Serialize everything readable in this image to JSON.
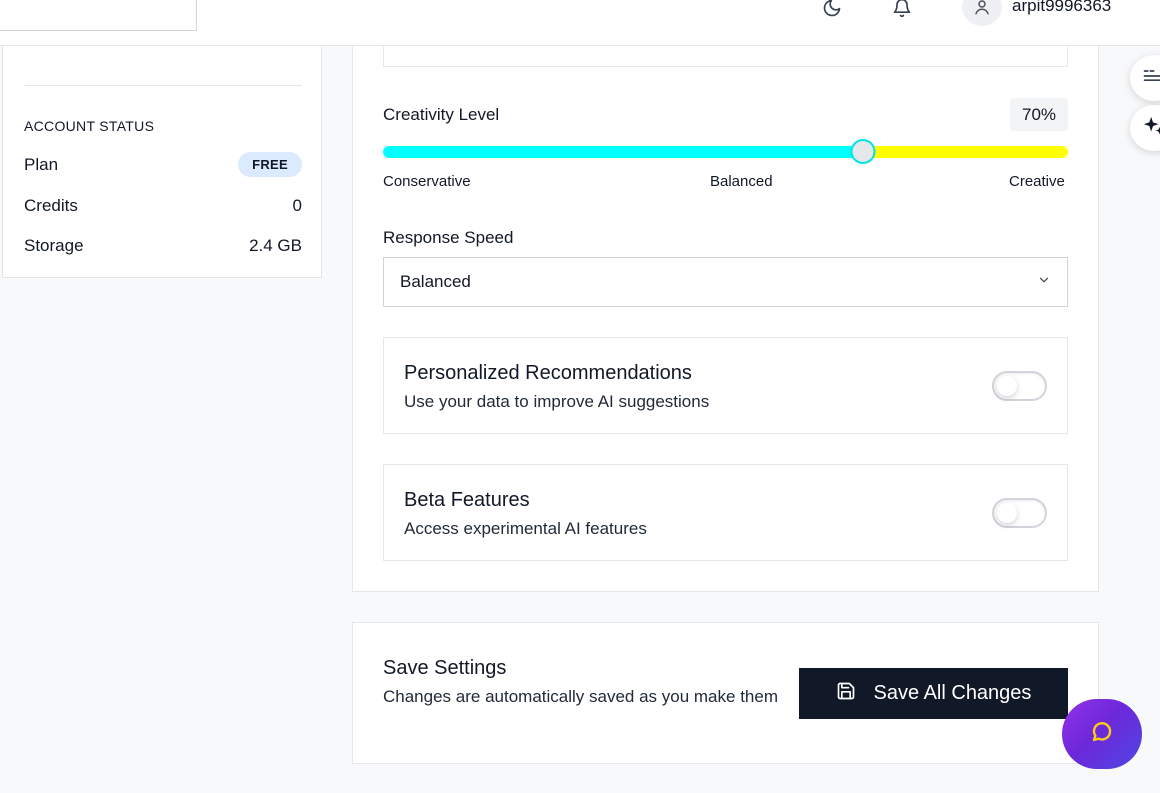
{
  "header": {
    "username": "arpit9996363",
    "icons": [
      "moon-icon",
      "bell-icon",
      "user-icon"
    ]
  },
  "account_status": {
    "title": "ACCOUNT STATUS",
    "plan_label": "Plan",
    "plan_value": "FREE",
    "credits_label": "Credits",
    "credits_value": "0",
    "storage_label": "Storage",
    "storage_value": "2.4 GB"
  },
  "creativity": {
    "label": "Creativity Level",
    "percent_text": "70%",
    "level": 0.7,
    "low_label": "Conservative",
    "mid_label": "Balanced",
    "high_label": "Creative"
  },
  "response_speed": {
    "label": "Response Speed",
    "selected": "Balanced"
  },
  "toggles": [
    {
      "title": "Personalized Recommendations",
      "description": "Use your data to improve AI suggestions",
      "enabled": false
    },
    {
      "title": "Beta Features",
      "description": "Access experimental AI features",
      "enabled": false
    }
  ],
  "save": {
    "title": "Save Settings",
    "description": "Changes are automatically saved as you make them",
    "button_label": "Save All Changes"
  },
  "colors": {
    "slider_fill": "#00ffff",
    "slider_track": "#ffff00",
    "save_button": "#111827",
    "plan_badge": "#dbeafe"
  }
}
